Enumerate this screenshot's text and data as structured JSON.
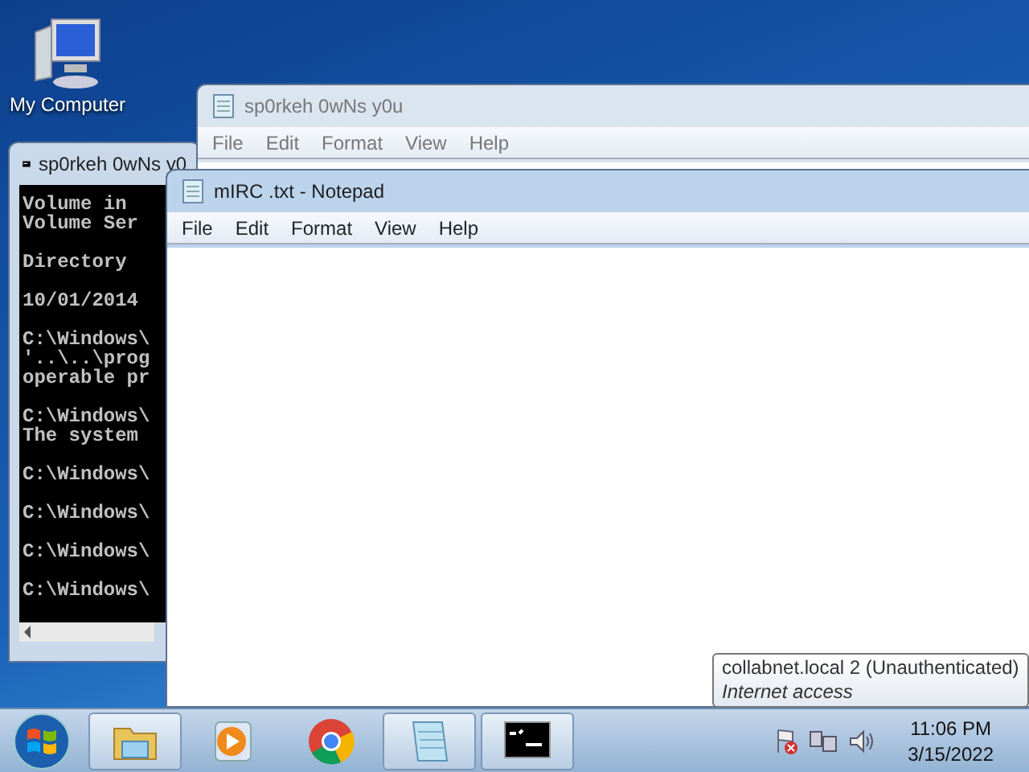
{
  "desktop_icons": [
    {
      "label": "My Computer"
    }
  ],
  "windows": [
    {
      "kind": "console",
      "title": "sp0rkeh 0wNs y0",
      "blocks": [
        [
          "Volume in",
          "Volume Ser"
        ],
        [
          "Directory"
        ],
        [
          "10/01/2014"
        ],
        [
          "C:\\Windows\\",
          "'..\\..\\prog",
          "operable pr"
        ],
        [
          "C:\\Windows\\",
          "The system"
        ],
        [
          "C:\\Windows\\"
        ],
        [
          "C:\\Windows\\"
        ],
        [
          "C:\\Windows\\"
        ],
        [
          "C:\\Windows\\"
        ]
      ]
    },
    {
      "kind": "notepad",
      "title": "sp0rkeh 0wNs y0u",
      "active": false,
      "menu": [
        "File",
        "Edit",
        "Format",
        "View",
        "Help"
      ]
    },
    {
      "kind": "notepad",
      "title": "mIRC .txt - Notepad",
      "active": true,
      "menu": [
        "File",
        "Edit",
        "Format",
        "View",
        "Help"
      ]
    }
  ],
  "tooltip": {
    "title": "collabnet.local  2 (Unauthenticated)",
    "subtitle": "Internet access"
  },
  "taskbar": {
    "items": [
      {
        "kind": "explorer",
        "running": true
      },
      {
        "kind": "media",
        "running": false
      },
      {
        "kind": "browser",
        "running": false
      },
      {
        "kind": "notepad",
        "running": true
      },
      {
        "kind": "console",
        "running": true
      }
    ],
    "tray": {
      "time": "11:06 PM",
      "date": "3/15/2022"
    }
  }
}
